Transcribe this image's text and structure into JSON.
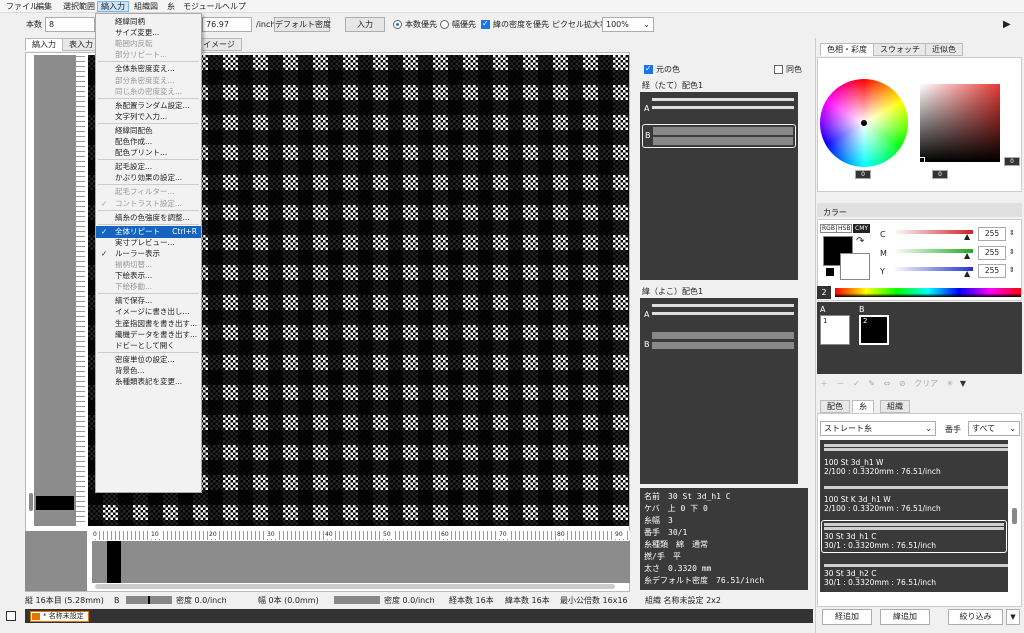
{
  "menubar": {
    "items": [
      "ファイル",
      "編集",
      "選択範囲",
      "縞入力",
      "組織図",
      "糸",
      "モジュール",
      "ヘルプ"
    ],
    "active_index": 3
  },
  "toolbar": {
    "count_label": "本数",
    "count_value": "8",
    "density_value": "76.97",
    "density_unit": "/inch",
    "default_density_button": "デフォルト密度",
    "input_button": "入力",
    "radio_count": "本数優先",
    "radio_width": "幅優先",
    "check_warp_density": "緯の密度を優先",
    "pixel_zoom_label": "ピクセル拡大率",
    "pixel_zoom_value": "100%"
  },
  "tabs": {
    "input": "縞入力",
    "table": "表入力",
    "image": "イメージ"
  },
  "colorset": {
    "original_color": "元の色",
    "same_color": "同色",
    "warp_title": "経（たて）配色1",
    "weft_title": "緯（よこ）配色1",
    "row_a": "A",
    "row_b": "B"
  },
  "info": {
    "lines": [
      "名前　30 St 3d_h1 C",
      "ケバ　上 0 下 0",
      "糸幅　3",
      "番手　30/1",
      "糸種類　綿　通常",
      "撚/手　平",
      "太さ　0.3320 mm",
      "糸デフォルト密度　76.51/inch"
    ]
  },
  "right": {
    "tabs": [
      "色相・彩度",
      "スウォッチ",
      "近似色"
    ],
    "hue_value": "0",
    "sat_value": "0",
    "bright_value": "0",
    "color_label": "カラー",
    "modes": [
      "RGB",
      "HSB",
      "CMY"
    ],
    "cmy": [
      {
        "name": "C",
        "value": "255",
        "color": "#cc2222"
      },
      {
        "name": "M",
        "value": "255",
        "color": "#22aa22"
      },
      {
        "name": "Y",
        "value": "255",
        "color": "#2233cc"
      }
    ],
    "spectrum_index": "2",
    "palette": [
      {
        "id": "A",
        "num": "1",
        "color": "#ffffff"
      },
      {
        "id": "B",
        "num": "2",
        "color": "#000000"
      }
    ],
    "palette_tools": [
      "＋",
      "－",
      "✓",
      "✎",
      "⇔",
      "⊘",
      "クリア",
      "✳",
      "▼"
    ],
    "yarn_tabs": [
      "配色",
      "糸",
      "組織"
    ],
    "yarn_filter": "ストレート糸",
    "number_label": "番手",
    "number_value": "すべて",
    "yarns": [
      {
        "name": "100 St 3d_h1 W",
        "spec": "2/100 : 0.3320mm : 76.51/inch"
      },
      {
        "name": "100 St K 3d_h1 W",
        "spec": "2/100 : 0.3320mm : 76.51/inch"
      },
      {
        "name": "30 St 3d_h1 C",
        "spec": "30/1 : 0.3320mm : 76.51/inch"
      },
      {
        "name": "30 St 3d_h2 C",
        "spec": "30/1 : 0.3320mm : 76.51/inch"
      }
    ],
    "buttons": {
      "warp_add": "経追加",
      "weft_add": "緯追加",
      "narrow": "絞り込み"
    }
  },
  "menu": [
    {
      "label": "経緯同柄",
      "dis": false
    },
    {
      "label": "サイズ変更...",
      "dis": false
    },
    {
      "label": "範囲内反転",
      "dis": true
    },
    {
      "label": "部分リピート...",
      "dis": true
    },
    {
      "sep": true
    },
    {
      "label": "全体糸密度変え...",
      "dis": false
    },
    {
      "label": "部分糸密度変え...",
      "dis": true
    },
    {
      "label": "同じ糸の密度変え...",
      "dis": true
    },
    {
      "sep": true
    },
    {
      "label": "糸配置ランダム設定...",
      "dis": false
    },
    {
      "label": "文字列で入力...",
      "dis": false
    },
    {
      "sep": true
    },
    {
      "label": "経緯同配色",
      "dis": false
    },
    {
      "label": "配色作成...",
      "dis": false
    },
    {
      "label": "配色プリント...",
      "dis": false
    },
    {
      "sep": true
    },
    {
      "label": "起毛設定...",
      "dis": false
    },
    {
      "label": "かぶり効果の設定...",
      "dis": false
    },
    {
      "sep": true
    },
    {
      "label": "起毛フィルター...",
      "dis": true
    },
    {
      "label": "コントラスト設定...",
      "dis": true,
      "check": true
    },
    {
      "sep": true
    },
    {
      "label": "縞糸の色強度を調整...",
      "dis": false
    },
    {
      "sep": true
    },
    {
      "label": "全体リピート",
      "dis": false,
      "check": true,
      "hl": true,
      "shortcut": "Ctrl+R"
    },
    {
      "label": "実寸プレビュー...",
      "dis": false
    },
    {
      "label": "ルーラー表示",
      "dis": false,
      "check": true
    },
    {
      "label": "揃柄切替...",
      "dis": true
    },
    {
      "label": "下絵表示...",
      "dis": false
    },
    {
      "label": "下絵移動...",
      "dis": true
    },
    {
      "sep": true
    },
    {
      "label": "縞で保存...",
      "dis": false
    },
    {
      "label": "イメージに書き出し...",
      "dis": false
    },
    {
      "label": "生産指図書を書き出す...",
      "dis": false
    },
    {
      "label": "織機データを書き出す...",
      "dis": false
    },
    {
      "label": "ドビーとして開く",
      "dis": false
    },
    {
      "sep": true
    },
    {
      "label": "密度単位の設定...",
      "dis": false
    },
    {
      "label": "背景色...",
      "dis": false
    },
    {
      "label": "糸種類表記を変更...",
      "dis": false
    }
  ],
  "ruler_ticks": [
    "0",
    "10",
    "20",
    "30",
    "40",
    "50",
    "60",
    "70",
    "80",
    "90"
  ],
  "status": {
    "count": "縦 16本目 (5.28mm)",
    "b": "B",
    "density1": "密度 0.0/inch",
    "width": "幅 0本 (0.0mm)",
    "density2": "密度 0.0/inch",
    "warp_count": "経本数 16本",
    "weft_count": "緯本数 16本",
    "min_repeat": "最小公倍数 16x16",
    "weave": "組織 名称未設定 2x2"
  },
  "taskbar": {
    "item": "* 名称未設定"
  }
}
